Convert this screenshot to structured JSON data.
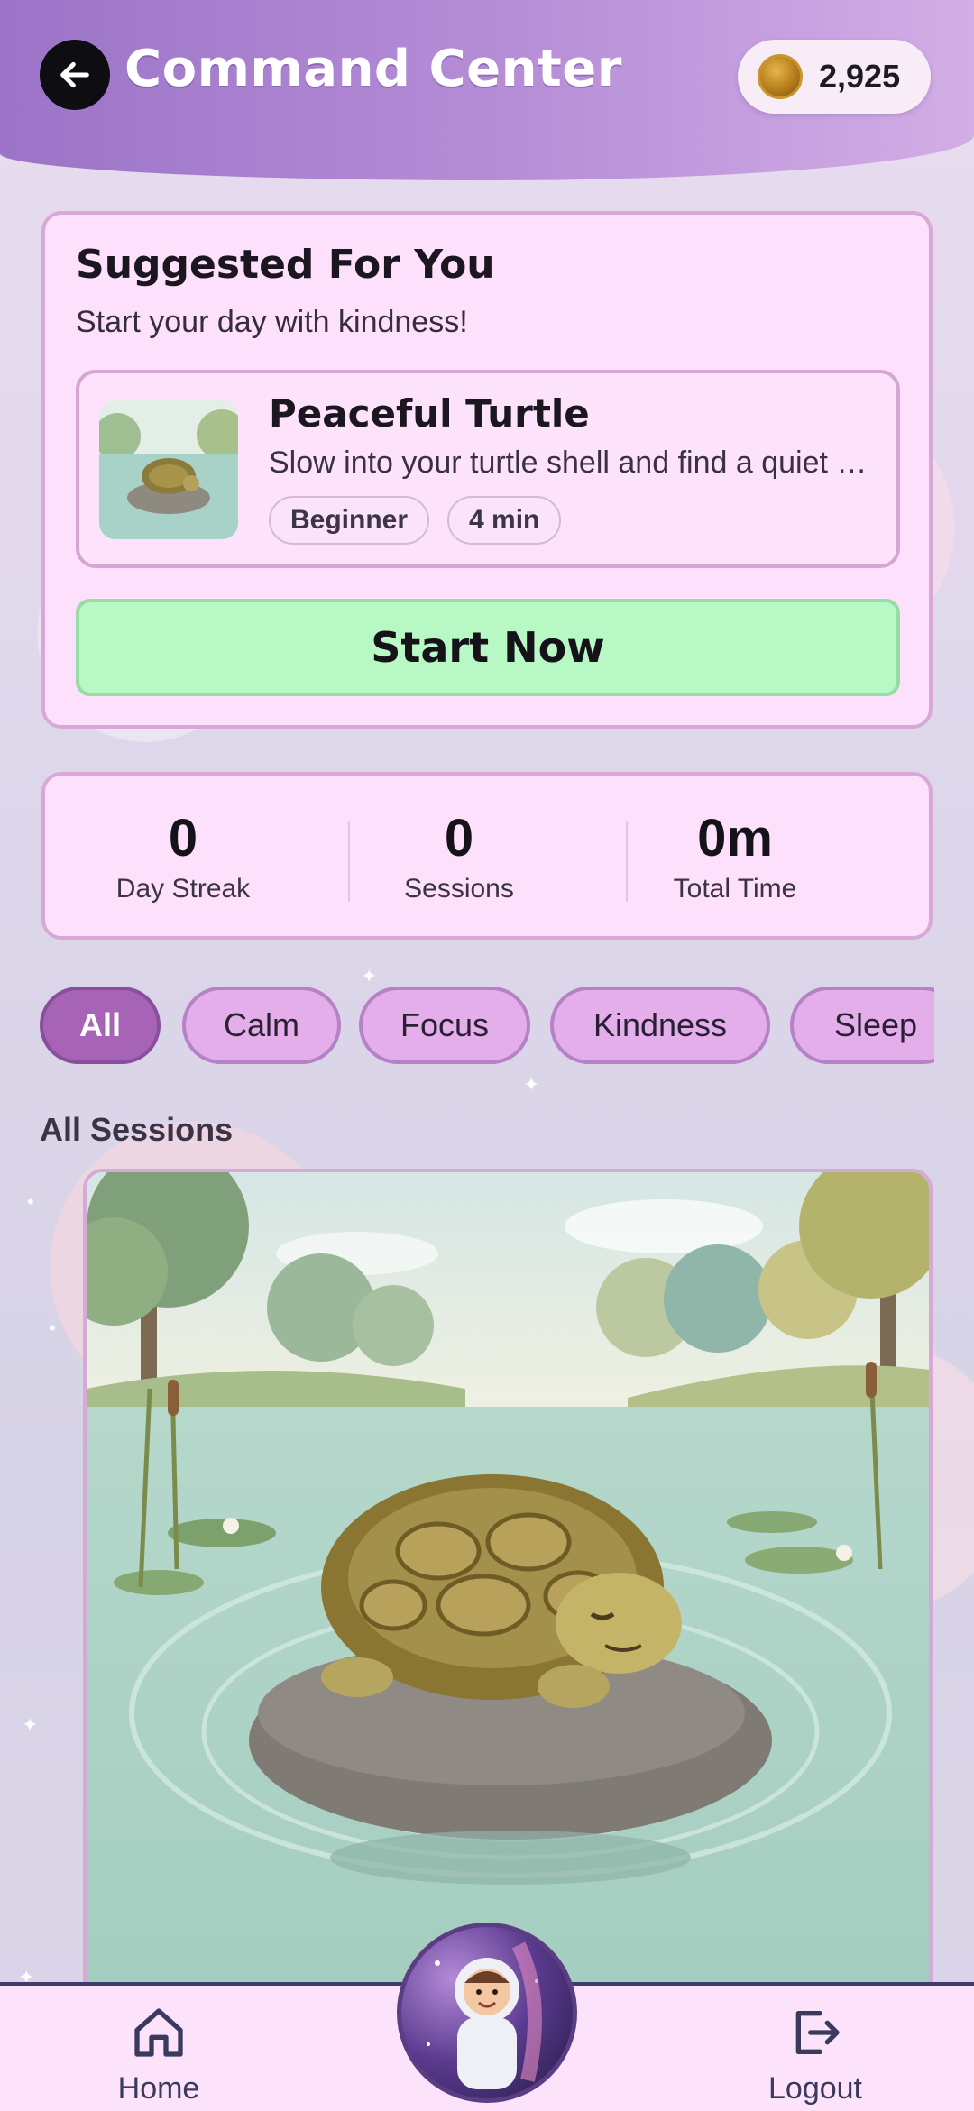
{
  "header": {
    "title": "Command Center",
    "coins": "2,925",
    "back_icon": "arrow-left-icon",
    "coin_icon": "coin-icon"
  },
  "suggested": {
    "title": "Suggested For You",
    "subtitle": "Start your day with kindness!",
    "session": {
      "name": "Peaceful Turtle",
      "description": "Slow into your turtle shell and find a quiet calm",
      "tags": [
        "Beginner",
        "4 min"
      ]
    },
    "cta": "Start Now"
  },
  "stats": [
    {
      "value": "0",
      "label": "Day Streak"
    },
    {
      "value": "0",
      "label": "Sessions"
    },
    {
      "value": "0m",
      "label": "Total Time"
    }
  ],
  "filters": {
    "items": [
      "All",
      "Calm",
      "Focus",
      "Kindness",
      "Sleep"
    ],
    "active": "All"
  },
  "sections": {
    "all_sessions_title": "All Sessions"
  },
  "bottom_nav": {
    "home_label": "Home",
    "logout_label": "Logout",
    "home_icon": "home-icon",
    "logout_icon": "logout-icon"
  },
  "colors": {
    "header_start": "#9c74c8",
    "header_end": "#d2aee6",
    "card_bg": "#fde0fb",
    "cta_bg": "#b8f8c4",
    "chip_active": "#a764b6",
    "chip_bg": "#e4aeea"
  }
}
